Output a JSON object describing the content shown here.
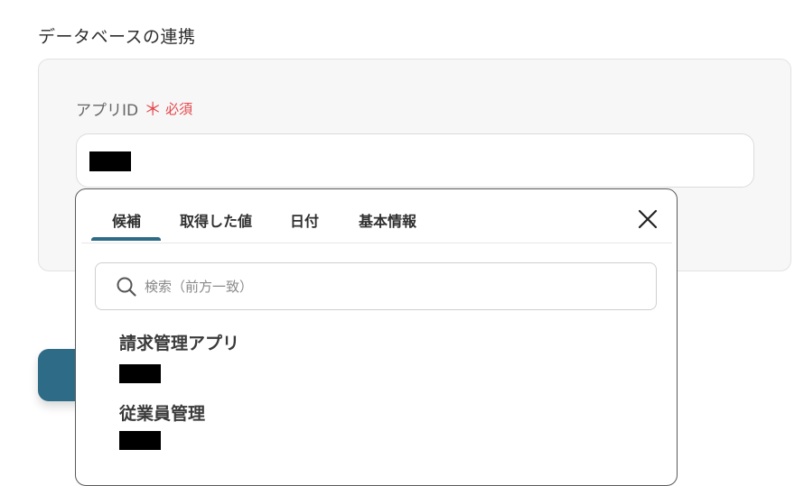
{
  "section": {
    "title": "データベースの連携"
  },
  "field": {
    "label": "アプリID",
    "required_mark": "＊",
    "required_text": "必須"
  },
  "dropdown": {
    "tabs": [
      {
        "label": "候補",
        "active": true
      },
      {
        "label": "取得した値",
        "active": false
      },
      {
        "label": "日付",
        "active": false
      },
      {
        "label": "基本情報",
        "active": false
      }
    ],
    "search": {
      "placeholder": "検索（前方一致）",
      "value": ""
    },
    "options": [
      {
        "name": "請求管理アプリ"
      },
      {
        "name": "従業員管理"
      }
    ],
    "close_icon": "close-icon"
  },
  "colors": {
    "accent": "#2e6b86",
    "required": "#e5484d"
  }
}
